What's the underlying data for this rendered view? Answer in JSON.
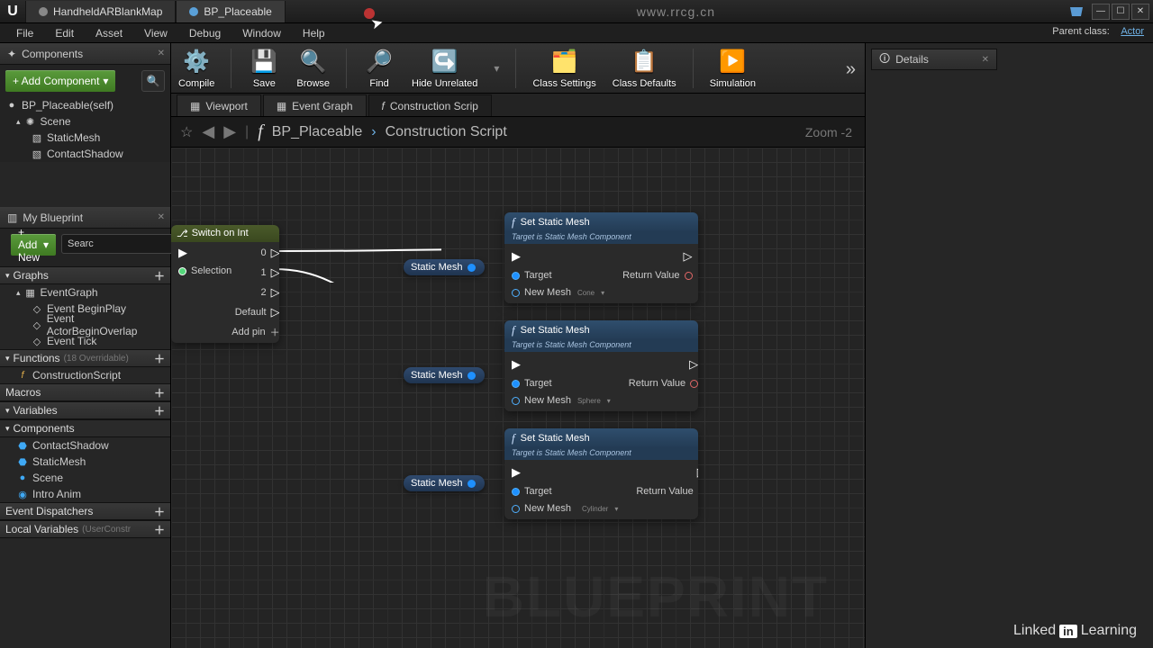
{
  "title": {
    "tab1": "HandheldARBlankMap",
    "tab2": "BP_Placeable",
    "url": "www.rrcg.cn"
  },
  "menu": {
    "file": "File",
    "edit": "Edit",
    "asset": "Asset",
    "view": "View",
    "debug": "Debug",
    "window": "Window",
    "help": "Help",
    "parent_lbl": "Parent class:",
    "parent_val": "Actor"
  },
  "components": {
    "panel": "Components",
    "add": "+ Add Component",
    "search_ph": "",
    "root": "BP_Placeable(self)",
    "scene": "Scene",
    "static": "StaticMesh",
    "contact": "ContactShadow"
  },
  "blueprint": {
    "panel": "My Blueprint",
    "add": "+ Add New",
    "search_ph": "Searc",
    "graphs": "Graphs",
    "event_graph": "EventGraph",
    "ev_begin": "Event BeginPlay",
    "ev_overlap": "Event ActorBeginOverlap",
    "ev_tick": "Event Tick",
    "functions": "Functions",
    "func_override": "(18 Overridable)",
    "cscript": "ConstructionScript",
    "macros": "Macros",
    "variables": "Variables",
    "comp_hdr": "Components",
    "v_contact": "ContactShadow",
    "v_static": "StaticMesh",
    "v_scene": "Scene",
    "v_intro": "Intro Anim",
    "disp": "Event Dispatchers",
    "localv": "Local Variables",
    "localv_dim": "(UserConstr"
  },
  "toolbar": {
    "compile": "Compile",
    "save": "Save",
    "browse": "Browse",
    "find": "Find",
    "hide": "Hide Unrelated",
    "cls_set": "Class Settings",
    "cls_def": "Class Defaults",
    "sim": "Simulation"
  },
  "subtabs": {
    "viewport": "Viewport",
    "event": "Event Graph",
    "constr": "Construction Scrip"
  },
  "bc": {
    "name": "BP_Placeable",
    "script": "Construction Script",
    "zoom": "Zoom -2"
  },
  "graph": {
    "bg": "BLUEPRINT",
    "switch": {
      "title": "Switch on Int",
      "selection": "Selection",
      "default": "Default",
      "addpin": "Add pin",
      "p0": "0",
      "p1": "1",
      "p2": "2"
    },
    "pill": "Static Mesh",
    "set": {
      "title": "Set Static Mesh",
      "subtitle": "Target is Static Mesh Component",
      "target": "Target",
      "newmesh": "New Mesh",
      "retval": "Return Value",
      "cone": "Cone",
      "sphere": "Sphere",
      "cyl": "Cylinder"
    }
  },
  "details": "Details",
  "linkedin_a": "Linked",
  "linkedin_b": "in",
  "linkedin_c": "Learning"
}
